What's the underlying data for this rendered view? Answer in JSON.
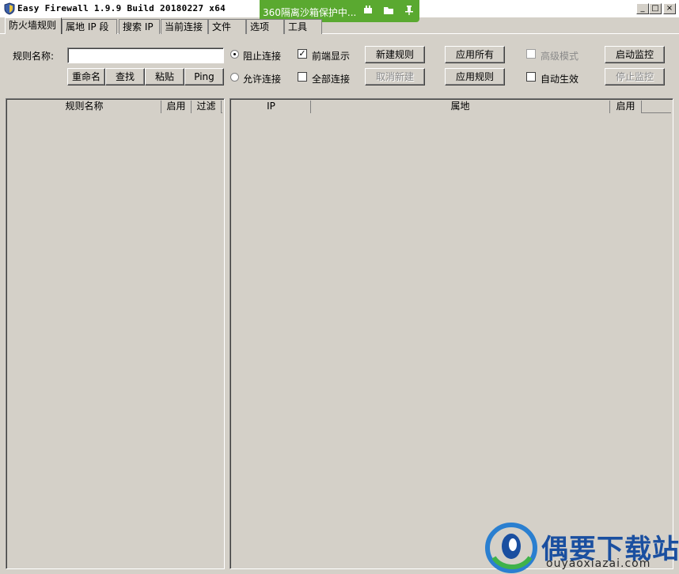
{
  "window": {
    "title": "Easy Firewall 1.9.9 Build 20180227 x64",
    "controls": {
      "minimize": "_",
      "maximize": "□",
      "close": "×"
    }
  },
  "sandbox_bar": {
    "text": "360隔离沙箱保护中...",
    "icons": [
      "plugin-icon",
      "folder-icon",
      "pin-icon"
    ]
  },
  "tabs": [
    {
      "label": "防火墙规则",
      "active": true
    },
    {
      "label": "属地 IP 段"
    },
    {
      "label": "搜索 IP"
    },
    {
      "label": "当前连接"
    },
    {
      "label": "文件"
    },
    {
      "label": "选项"
    },
    {
      "label": "工具"
    }
  ],
  "form": {
    "rule_name_label": "规则名称:",
    "rule_name_value": "",
    "rename_button": "重命名",
    "find_button": "查找",
    "paste_button": "粘贴",
    "ping_button": "Ping",
    "block_radio": {
      "label": "阻止连接",
      "checked": true
    },
    "allow_radio": {
      "label": "允许连接",
      "checked": false
    },
    "front_display": {
      "label": "前端显示",
      "checked": true
    },
    "all_connections": {
      "label": "全部连接",
      "checked": false
    },
    "new_rule_button": "新建规则",
    "cancel_new_button": "取消新建",
    "apply_all_button": "应用所有",
    "apply_rule_button": "应用规则",
    "advanced_mode": {
      "label": "高级模式",
      "checked": false,
      "disabled": true
    },
    "auto_apply": {
      "label": "自动生效",
      "checked": false
    },
    "start_monitor_button": "启动监控",
    "stop_monitor_button": "停止监控"
  },
  "rules_list": {
    "columns": [
      "规则名称",
      "启用",
      "过滤"
    ],
    "rows": []
  },
  "ip_list": {
    "columns": [
      "IP",
      "属地",
      "启用"
    ],
    "rows": []
  },
  "watermark": {
    "title": "偶要下载站",
    "url": "ouyaoxiazai.com"
  },
  "colors": {
    "face": "#d4d0c8",
    "sandbox_green": "#5aa930",
    "watermark_blue": "#1a4fa0"
  }
}
